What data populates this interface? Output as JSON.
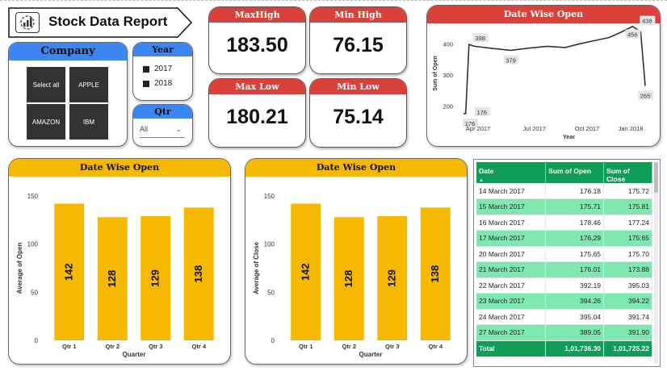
{
  "title": "Stock Data Report",
  "company": {
    "header": "Company",
    "tiles": [
      "Select all",
      "APPLE",
      "AMAZON",
      "IBM"
    ]
  },
  "year": {
    "header": "Year",
    "options": [
      "2017",
      "2018"
    ]
  },
  "qtr": {
    "header": "Qtr",
    "selected": "All"
  },
  "kpis": {
    "max_high": {
      "label": "MaxHigh",
      "value": "183.50"
    },
    "min_high": {
      "label": "Min High",
      "value": "76.15"
    },
    "max_low": {
      "label": "Max Low",
      "value": "180.21"
    },
    "min_low": {
      "label": "Min Low",
      "value": "75.14"
    }
  },
  "colors": {
    "red": "#d9413a",
    "blue": "#3b86f0",
    "yellow": "#f6b800",
    "green": "#0f9d58",
    "light_green": "#7ee8b0",
    "tile": "#333333"
  },
  "chart_data": [
    {
      "type": "line",
      "title": "Date Wise Open",
      "xlabel": "Year",
      "ylabel": "Sum of Open",
      "xticks": [
        "Apr 2017",
        "Jul 2017",
        "Oct 2017",
        "Jan 2018"
      ],
      "yticks": [
        200,
        300,
        400
      ],
      "ylim": [
        160,
        450
      ],
      "x": [
        "Mar 14 2017",
        "Mar 16 2017",
        "Mar 21 2017",
        "Apr 2017",
        "May 2017",
        "Jun 2017",
        "Jul 2017",
        "Aug 2017",
        "Sep 2017",
        "Oct 2017",
        "Nov 2017",
        "Dec 2017",
        "Jan 2018",
        "Feb 2018",
        "Mar 2018",
        "Mar 2018 end"
      ],
      "values": [
        176,
        176,
        398,
        392,
        385,
        379,
        386,
        392,
        388,
        400,
        410,
        420,
        438,
        456,
        438,
        265
      ],
      "annotations": [
        "176",
        "176",
        "398",
        "379",
        "456",
        "438",
        "265"
      ],
      "grid": false
    },
    {
      "type": "bar",
      "title": "Date Wise Open",
      "xlabel": "Quarter",
      "ylabel": "Average of Open",
      "categories": [
        "Qtr 1",
        "Qtr 2",
        "Qtr 3",
        "Qtr 4"
      ],
      "values": [
        142,
        128,
        129,
        138
      ],
      "yticks": [
        0,
        50,
        100,
        150
      ],
      "ylim": [
        0,
        150
      ],
      "grid": false
    },
    {
      "type": "bar",
      "title": "Date Wise Open",
      "xlabel": "Quarter",
      "ylabel": "Average of Close",
      "categories": [
        "Qtr 1",
        "Qtr 2",
        "Qtr 3",
        "Qtr 4"
      ],
      "values": [
        142,
        128,
        129,
        138
      ],
      "yticks": [
        0,
        50,
        100,
        150
      ],
      "ylim": [
        0,
        150
      ],
      "grid": false
    }
  ],
  "table": {
    "columns": [
      "Date",
      "Sum of Open",
      "Sum of Close"
    ],
    "rows": [
      [
        "14 March 2017",
        "176.18",
        "175.72"
      ],
      [
        "15 March 2017",
        "175.71",
        "175.81"
      ],
      [
        "16 March 2017",
        "178.46",
        "177.24"
      ],
      [
        "17 March 2017",
        "176.29",
        "175.65"
      ],
      [
        "20 March 2017",
        "175.65",
        "175.70"
      ],
      [
        "21 March 2017",
        "176.01",
        "173.88"
      ],
      [
        "22 March 2017",
        "392.19",
        "395.03"
      ],
      [
        "23 March 2017",
        "394.26",
        "394.22"
      ],
      [
        "24 March 2017",
        "395.04",
        "391.74"
      ],
      [
        "27 March 2017",
        "389.05",
        "391.90"
      ]
    ],
    "total": [
      "Total",
      "1,01,736.30",
      "1,01,725.22"
    ]
  }
}
